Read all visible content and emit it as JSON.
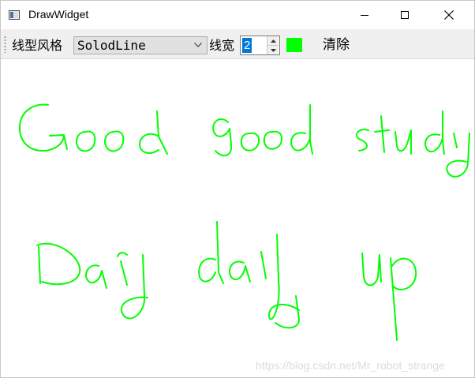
{
  "window": {
    "title": "DrawWidget"
  },
  "toolbar": {
    "line_style_label": "线型风格",
    "line_style_value": "SolodLine",
    "line_width_label": "线宽",
    "line_width_value": "2",
    "current_color": "#00ff00",
    "clear_label": "清除"
  },
  "canvas": {
    "stroke_color": "#00ff00"
  },
  "watermark": "https://blog.csdn.net/Mr_robot_strange"
}
